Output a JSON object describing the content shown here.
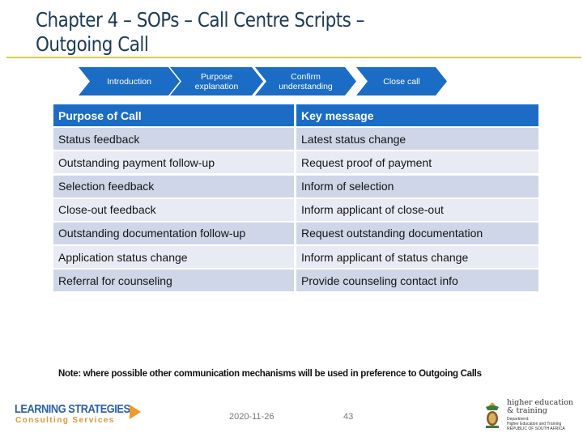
{
  "slide": {
    "title_line1": "Chapter 4 – SOPs – Call Centre Scripts –",
    "title_line2": "Outgoing Call"
  },
  "process": {
    "steps": [
      {
        "line1": "Introduction",
        "line2": ""
      },
      {
        "line1": "Purpose",
        "line2": "explanation"
      },
      {
        "line1": "Confirm",
        "line2": "understanding"
      },
      {
        "line1": "Close call",
        "line2": ""
      }
    ]
  },
  "table": {
    "headers": [
      "Purpose of Call",
      "Key message"
    ],
    "rows": [
      [
        "Status feedback",
        "Latest status change"
      ],
      [
        "Outstanding payment follow-up",
        "Request proof of payment"
      ],
      [
        "Selection feedback",
        "Inform of selection"
      ],
      [
        "Close-out feedback",
        "Inform applicant of close-out"
      ],
      [
        "Outstanding documentation follow-up",
        "Request outstanding documentation"
      ],
      [
        "Application status change",
        "Inform applicant of status change"
      ],
      [
        "Referral for counseling",
        "Provide counseling contact info"
      ]
    ]
  },
  "note": "Note: where possible other communication mechanisms will be used in preference to Outgoing Calls",
  "footer": {
    "left_logo": {
      "title": "LEARNING STRATEGIES",
      "subtitle": "Consulting Services"
    },
    "date": "2020-11-26",
    "page_number": "43",
    "right_logo": {
      "title": "higher education\n& training",
      "subtitle": "Department:\nHigher Education and Training\nREPUBLIC OF SOUTH AFRICA"
    }
  },
  "colors": {
    "accent_blue": "#1c6cc6",
    "row_dark": "#cfd6e8",
    "row_light": "#e8ebf3",
    "title_text": "#1d3a57",
    "title_rule": "#dcc85a"
  }
}
